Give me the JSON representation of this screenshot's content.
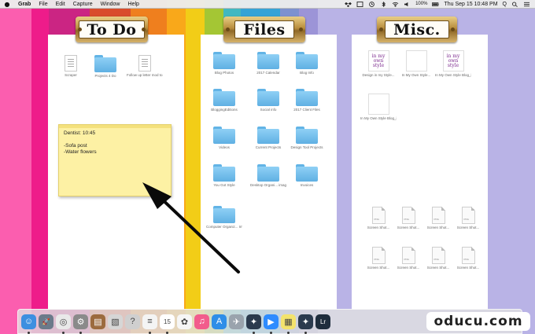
{
  "menubar": {
    "app_name": "Grab",
    "items": [
      "File",
      "Edit",
      "Capture",
      "Window",
      "Help"
    ],
    "clock": "Thu Sep 15  10:48 PM",
    "battery": "100%",
    "user": "Q"
  },
  "wallpaper_colors": [
    "#fb5eaf",
    "#ee1c8a",
    "#cb2583",
    "#d94c2c",
    "#ef7f1e",
    "#f9a81a",
    "#f2cd17",
    "#a4c634",
    "#42b8c1",
    "#35a3d6",
    "#7d91cf",
    "#9c94d7",
    "#b9b3e6"
  ],
  "panels": {
    "todo": {
      "title": "To Do",
      "icons": [
        {
          "label": "Scraper",
          "type": "doc"
        },
        {
          "label": "Projects 4 Do",
          "type": "folder"
        },
        {
          "label": "Follow up letter mod to...",
          "type": "doc"
        }
      ]
    },
    "files": {
      "title": "Files",
      "icons": [
        {
          "label": "Blog Photos",
          "type": "folder"
        },
        {
          "label": "2017 Calendar",
          "type": "folder"
        },
        {
          "label": "Blog Info",
          "type": "folder"
        },
        {
          "label": "BloggingEditions",
          "type": "folder"
        },
        {
          "label": "Social info",
          "type": "folder"
        },
        {
          "label": "2017 Client Files",
          "type": "folder"
        },
        {
          "label": "Videos",
          "type": "folder"
        },
        {
          "label": "Current Projects",
          "type": "folder"
        },
        {
          "label": "Design Tool Projects",
          "type": "folder"
        },
        {
          "label": "You Got Style",
          "type": "folder"
        },
        {
          "label": "Desktop Organi... images",
          "type": "folder"
        },
        {
          "label": "Invoices",
          "type": "folder"
        },
        {
          "label": "Computer Organiz... Images",
          "type": "folder"
        }
      ]
    },
    "misc": {
      "title": "Misc.",
      "icons": [
        {
          "label": "Design in my Style...",
          "type": "thumb",
          "text": "in my own style"
        },
        {
          "label": "In My Own Style...",
          "type": "thumb",
          "text": ""
        },
        {
          "label": "In My Own Style Blog_ic...",
          "type": "thumb",
          "text": "in my own style"
        },
        {
          "label": "In My Own Style Blog_ic...",
          "type": "thumb",
          "text": ""
        },
        {
          "label": "Screen Shot...",
          "type": "img"
        },
        {
          "label": "Screen Shot...",
          "type": "img"
        },
        {
          "label": "Screen Shot...",
          "type": "img"
        },
        {
          "label": "Screen Shot...",
          "type": "img"
        },
        {
          "label": "Screen Shot...",
          "type": "img"
        },
        {
          "label": "Screen Shot...",
          "type": "img"
        },
        {
          "label": "Screen Shot...",
          "type": "img"
        },
        {
          "label": "Screen Shot...",
          "type": "img"
        }
      ]
    }
  },
  "sticky_note": {
    "title": "Dentist: 10:45",
    "lines": [
      "-Sofa post",
      "-Water flowers"
    ]
  },
  "dock": {
    "apps": [
      {
        "name": "finder-icon",
        "color": "#3d8fe0",
        "glyph": "☺"
      },
      {
        "name": "launchpad-icon",
        "color": "#6b7a8a",
        "glyph": "🚀"
      },
      {
        "name": "chrome-icon",
        "color": "#e9e9e9",
        "glyph": "◎"
      },
      {
        "name": "system-preferences-icon",
        "color": "#8a8a8a",
        "glyph": "⚙"
      },
      {
        "name": "notebook-icon",
        "color": "#9c6b3e",
        "glyph": "▤"
      },
      {
        "name": "preview-icon",
        "color": "#d6d6d6",
        "glyph": "▧"
      },
      {
        "name": "help-icon",
        "color": "#cfcfcf",
        "glyph": "?"
      },
      {
        "name": "textedit-icon",
        "color": "#f4f4f4",
        "glyph": "≡"
      },
      {
        "name": "calendar-icon",
        "color": "#ffffff",
        "glyph": "15"
      },
      {
        "name": "photos-icon",
        "color": "#f6f6f6",
        "glyph": "✿"
      },
      {
        "name": "itunes-icon",
        "color": "#f25c8c",
        "glyph": "♫"
      },
      {
        "name": "app-store-icon",
        "color": "#2f8ee8",
        "glyph": "A"
      },
      {
        "name": "automator-icon",
        "color": "#9aa3ad",
        "glyph": "✈"
      },
      {
        "name": "gear-app-icon",
        "color": "#2b3a4e",
        "glyph": "✦"
      },
      {
        "name": "zoom-icon",
        "color": "#2d8cff",
        "glyph": "▶"
      },
      {
        "name": "stickies-icon",
        "color": "#f3e36d",
        "glyph": "▦"
      },
      {
        "name": "screenshot-app-icon",
        "color": "#2b3a4e",
        "glyph": "✦"
      },
      {
        "name": "lightroom-icon",
        "color": "#1f2d3d",
        "glyph": "Lr"
      }
    ]
  },
  "watermark": "oducu.com"
}
